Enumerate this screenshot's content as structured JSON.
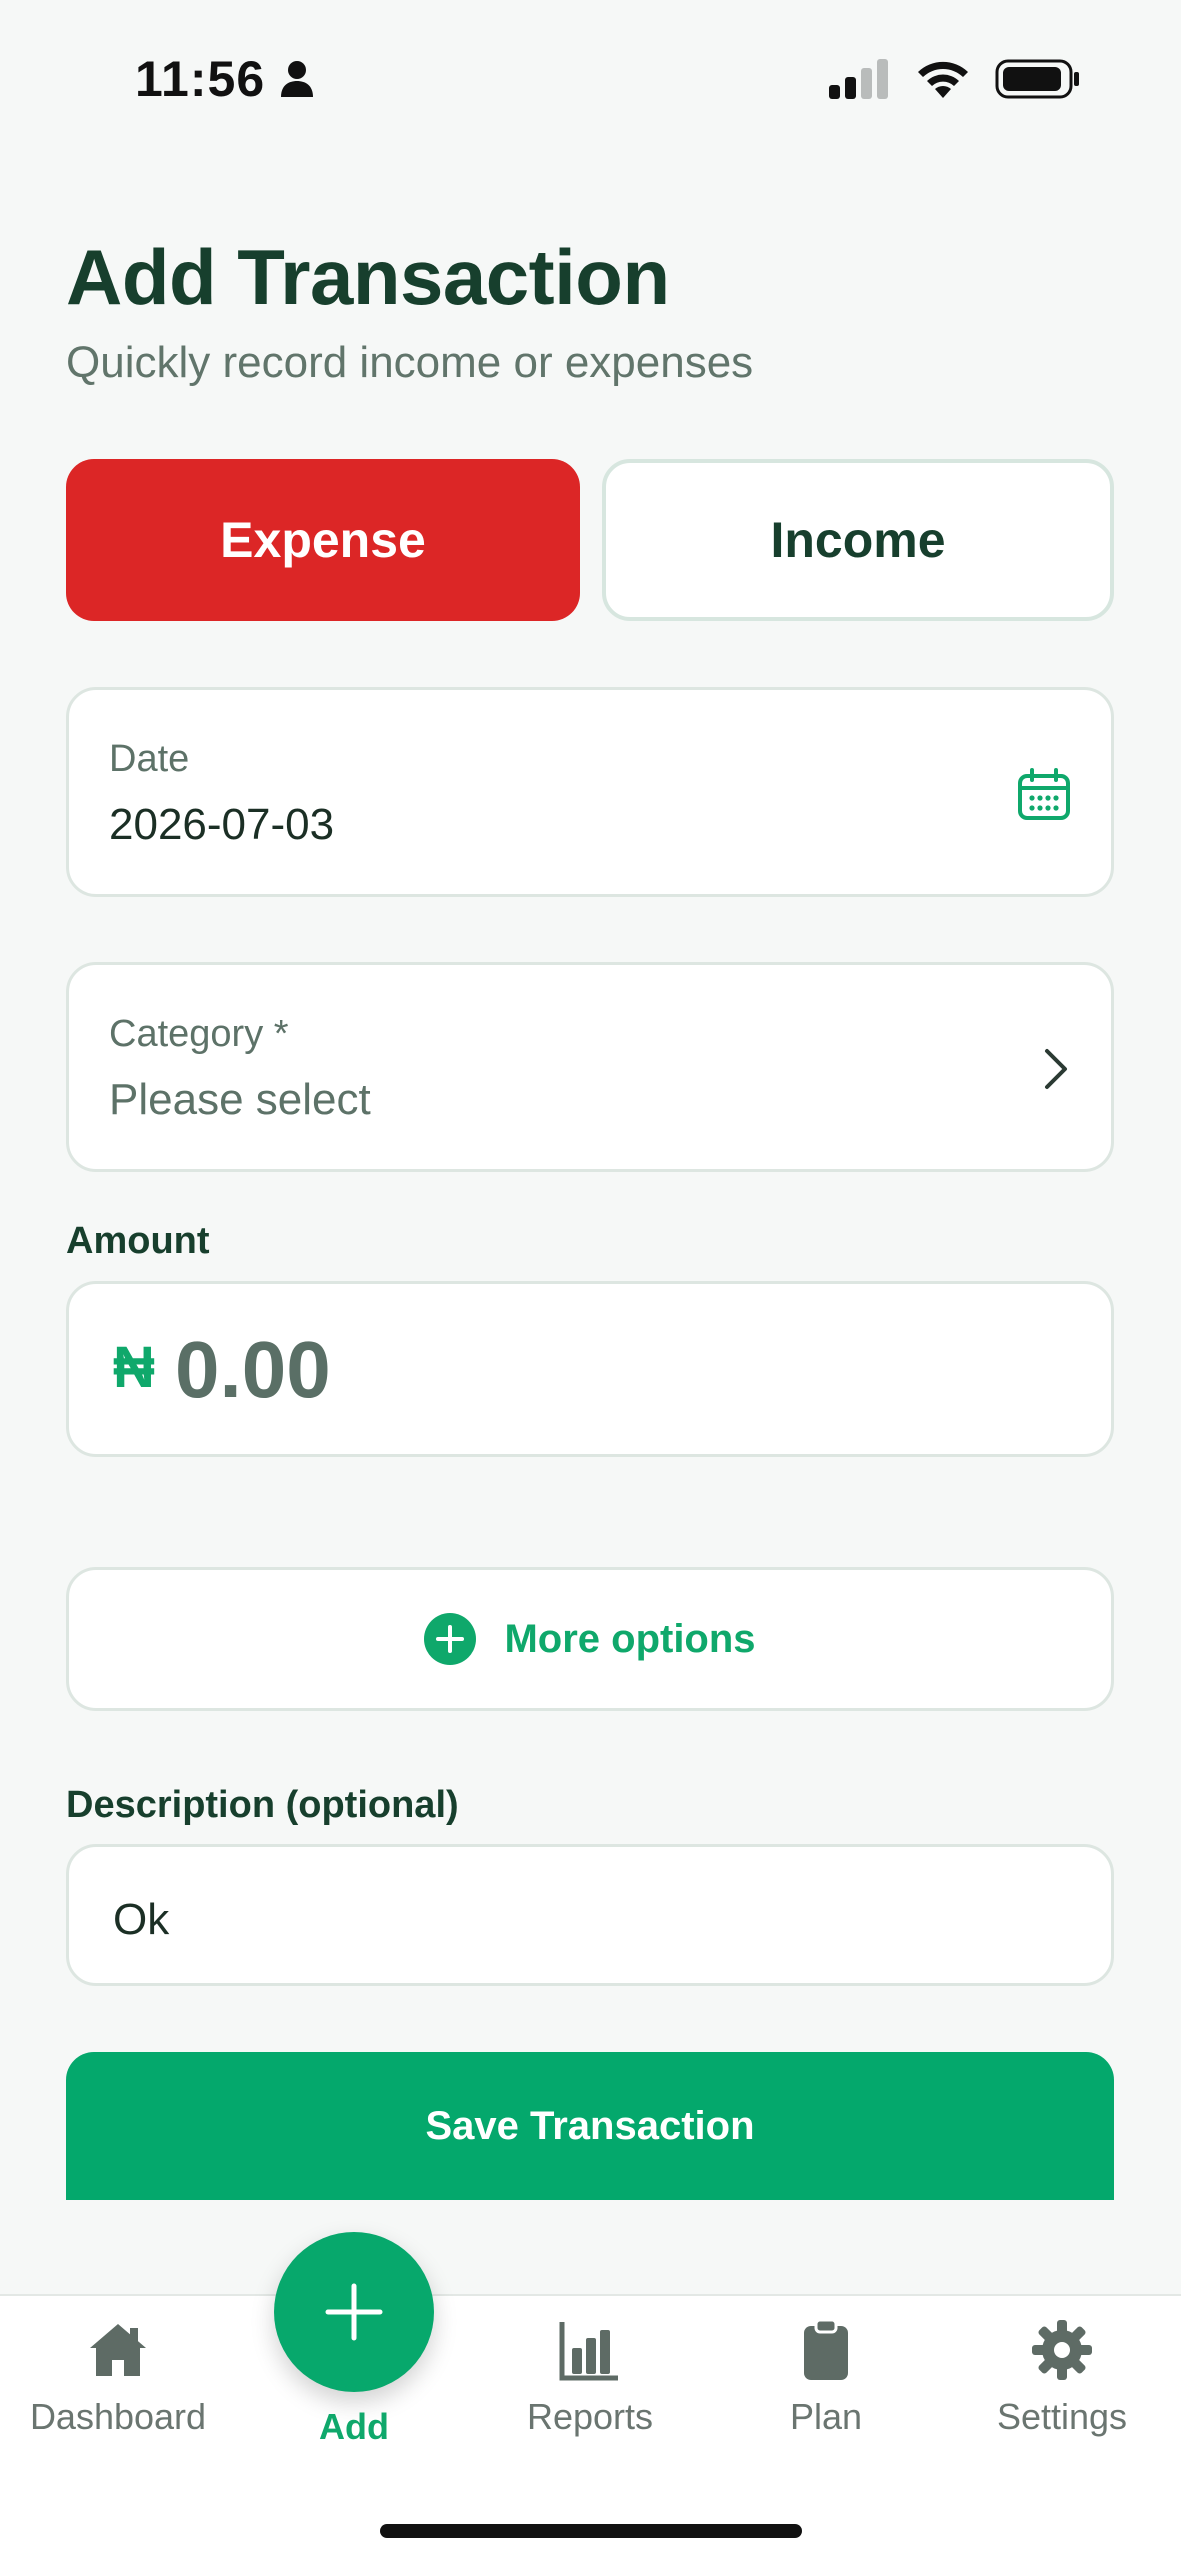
{
  "status_bar": {
    "time": "11:56"
  },
  "header": {
    "title": "Add Transaction",
    "subtitle": "Quickly record income or expenses"
  },
  "type_toggle": {
    "expense_label": "Expense",
    "income_label": "Income",
    "selected": "Expense"
  },
  "date_field": {
    "label": "Date",
    "value": "2026-07-03"
  },
  "category_field": {
    "label": "Category *",
    "value": "Please select"
  },
  "amount_field": {
    "label": "Amount",
    "currency": "₦",
    "value": "0.00"
  },
  "more_options": {
    "label": "More options"
  },
  "description_field": {
    "label": "Description (optional)",
    "value": "Ok"
  },
  "save_button": {
    "label": "Save Transaction"
  },
  "bottom_nav": {
    "items": [
      {
        "label": "Dashboard",
        "icon": "home-icon"
      },
      {
        "label": "Add",
        "icon": "plus-icon"
      },
      {
        "label": "Reports",
        "icon": "bar-chart-icon"
      },
      {
        "label": "Plan",
        "icon": "clipboard-icon"
      },
      {
        "label": "Settings",
        "icon": "gear-icon"
      }
    ],
    "active": "Add"
  },
  "colors": {
    "accent": "#04a86c",
    "expense": "#dc2626",
    "title": "#173f2d",
    "background": "#f6f8f7"
  }
}
